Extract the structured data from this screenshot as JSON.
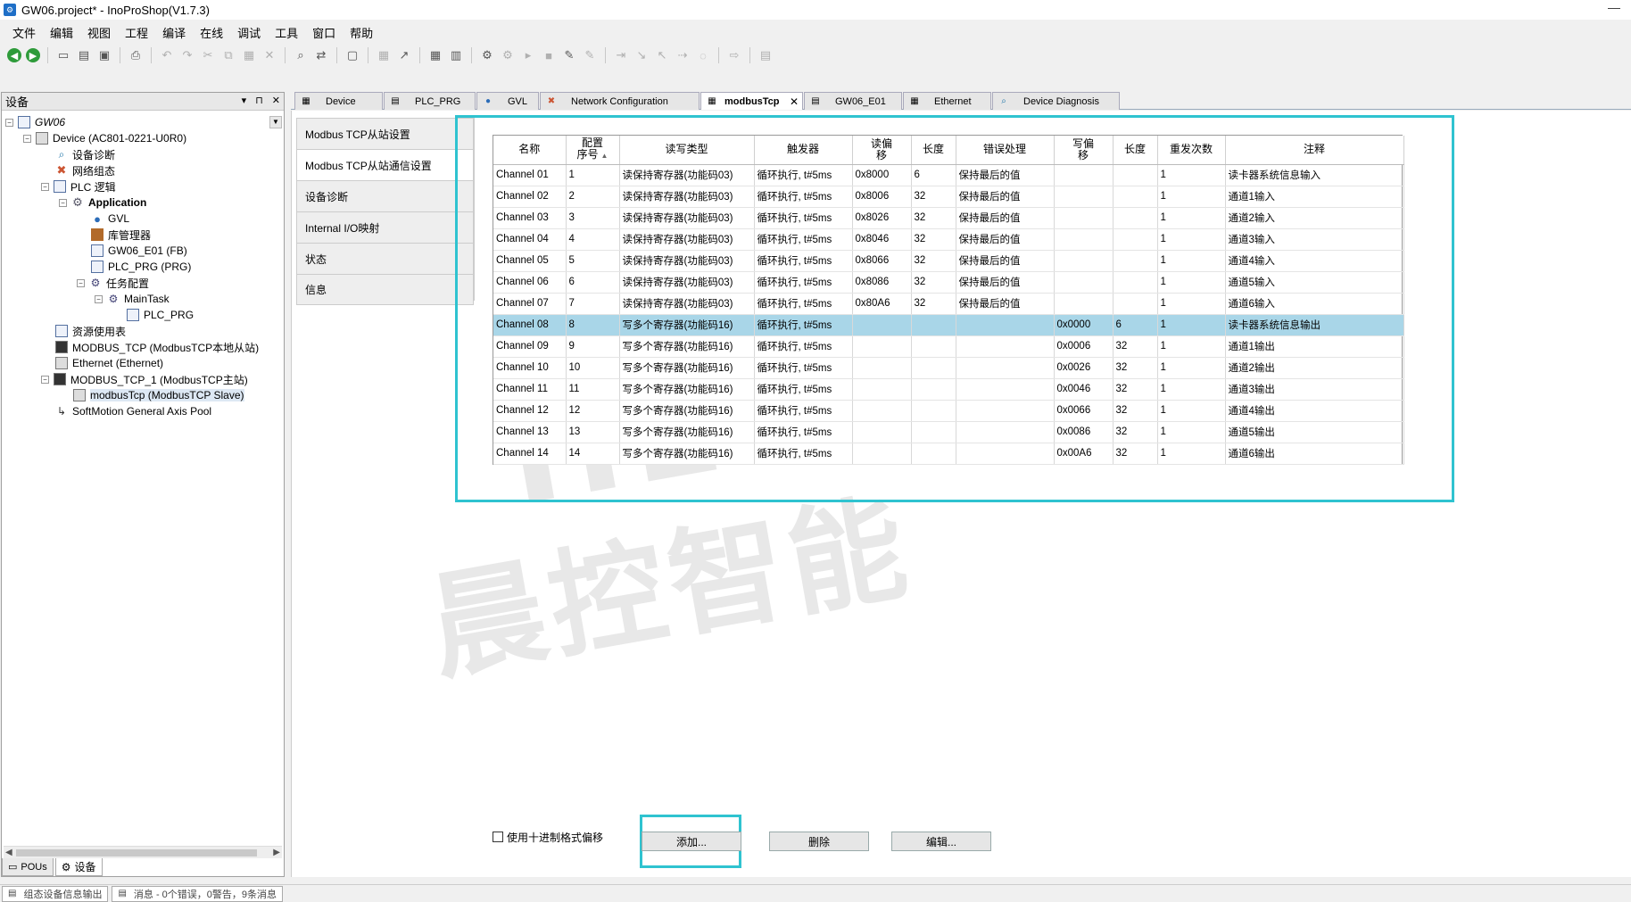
{
  "window": {
    "title": "GW06.project* - InoProShop(V1.7.3)",
    "minimize": "—"
  },
  "menu": [
    "文件",
    "编辑",
    "视图",
    "工程",
    "编译",
    "在线",
    "调试",
    "工具",
    "窗口",
    "帮助"
  ],
  "device_panel": {
    "title": "设备",
    "pin": "⊓",
    "close": "✕",
    "dropdown": "▾",
    "root": "GW06",
    "nodes": [
      {
        "label": "Device (AC801-0221-U0R0)",
        "icon": "device-icon"
      },
      {
        "label": "设备诊断",
        "icon": "diagnosis-icon"
      },
      {
        "label": "网络组态",
        "icon": "network-config-icon"
      },
      {
        "label": "PLC 逻辑",
        "icon": "plc-logic-icon"
      },
      {
        "label": "Application",
        "icon": "application-gear-icon"
      },
      {
        "label": "GVL",
        "icon": "gvl-globe-icon"
      },
      {
        "label": "库管理器",
        "icon": "library-manager-icon"
      },
      {
        "label": "GW06_E01 (FB)",
        "icon": "fb-document-icon"
      },
      {
        "label": "PLC_PRG (PRG)",
        "icon": "prg-document-icon"
      },
      {
        "label": "任务配置",
        "icon": "task-config-icon"
      },
      {
        "label": "MainTask",
        "icon": "task-icon"
      },
      {
        "label": "PLC_PRG",
        "icon": "prg-call-icon"
      },
      {
        "label": "资源使用表",
        "icon": "resource-table-icon"
      },
      {
        "label": "MODBUS_TCP (ModbusTCP本地从站)",
        "icon": "modbus-device-icon"
      },
      {
        "label": "Ethernet (Ethernet)",
        "icon": "ethernet-device-icon"
      },
      {
        "label": "MODBUS_TCP_1 (ModbusTCP主站)",
        "icon": "modbus-device-icon"
      },
      {
        "label": "modbusTcp (ModbusTCP Slave)",
        "icon": "modbus-slave-icon"
      },
      {
        "label": "SoftMotion General Axis Pool",
        "icon": "axis-pool-icon"
      }
    ],
    "bottom_tabs": [
      "POUs",
      "设备"
    ]
  },
  "doc_tabs": [
    {
      "label": "Device",
      "icon": "device-icon"
    },
    {
      "label": "PLC_PRG",
      "icon": "document-icon"
    },
    {
      "label": "GVL",
      "icon": "globe-icon"
    },
    {
      "label": "Network Configuration",
      "icon": "network-config-icon"
    },
    {
      "label": "modbusTcp",
      "icon": "device-icon",
      "close": "✕"
    },
    {
      "label": "GW06_E01",
      "icon": "document-icon"
    },
    {
      "label": "Ethernet",
      "icon": "device-icon"
    },
    {
      "label": "Device Diagnosis",
      "icon": "diagnosis-icon"
    }
  ],
  "side_nav": [
    "Modbus TCP从站设置",
    "Modbus TCP从站通信设置",
    "设备诊断",
    "Internal I/O映射",
    "状态",
    "信息"
  ],
  "table": {
    "headers": [
      "名称",
      "配置序号",
      "读写类型",
      "触发器",
      "读偏移",
      "长度",
      "错误处理",
      "写偏移",
      "长度",
      "重发次数",
      "注释"
    ],
    "header_lines": [
      [
        "名称"
      ],
      [
        "配置",
        "序号"
      ],
      [
        "读写类型"
      ],
      [
        "触发器"
      ],
      [
        "读偏",
        "移"
      ],
      [
        "长度"
      ],
      [
        "错误处理"
      ],
      [
        "写偏",
        "移"
      ],
      [
        "长度"
      ],
      [
        "重发次数"
      ],
      [
        "注释"
      ]
    ],
    "sort_indicator": "▲",
    "rows": [
      [
        "Channel 01",
        "1",
        "读保持寄存器(功能码03)",
        "循环执行, t#5ms",
        "0x8000",
        "6",
        "保持最后的值",
        "",
        "",
        "1",
        "读卡器系统信息输入"
      ],
      [
        "Channel 02",
        "2",
        "读保持寄存器(功能码03)",
        "循环执行, t#5ms",
        "0x8006",
        "32",
        "保持最后的值",
        "",
        "",
        "1",
        "通道1输入"
      ],
      [
        "Channel 03",
        "3",
        "读保持寄存器(功能码03)",
        "循环执行, t#5ms",
        "0x8026",
        "32",
        "保持最后的值",
        "",
        "",
        "1",
        "通道2输入"
      ],
      [
        "Channel 04",
        "4",
        "读保持寄存器(功能码03)",
        "循环执行, t#5ms",
        "0x8046",
        "32",
        "保持最后的值",
        "",
        "",
        "1",
        "通道3输入"
      ],
      [
        "Channel 05",
        "5",
        "读保持寄存器(功能码03)",
        "循环执行, t#5ms",
        "0x8066",
        "32",
        "保持最后的值",
        "",
        "",
        "1",
        "通道4输入"
      ],
      [
        "Channel 06",
        "6",
        "读保持寄存器(功能码03)",
        "循环执行, t#5ms",
        "0x8086",
        "32",
        "保持最后的值",
        "",
        "",
        "1",
        "通道5输入"
      ],
      [
        "Channel 07",
        "7",
        "读保持寄存器(功能码03)",
        "循环执行, t#5ms",
        "0x80A6",
        "32",
        "保持最后的值",
        "",
        "",
        "1",
        "通道6输入"
      ],
      [
        "Channel 08",
        "8",
        "写多个寄存器(功能码16)",
        "循环执行, t#5ms",
        "",
        "",
        "",
        "0x0000",
        "6",
        "1",
        "读卡器系统信息输出"
      ],
      [
        "Channel 09",
        "9",
        "写多个寄存器(功能码16)",
        "循环执行, t#5ms",
        "",
        "",
        "",
        "0x0006",
        "32",
        "1",
        "通道1输出"
      ],
      [
        "Channel 10",
        "10",
        "写多个寄存器(功能码16)",
        "循环执行, t#5ms",
        "",
        "",
        "",
        "0x0026",
        "32",
        "1",
        "通道2输出"
      ],
      [
        "Channel 11",
        "11",
        "写多个寄存器(功能码16)",
        "循环执行, t#5ms",
        "",
        "",
        "",
        "0x0046",
        "32",
        "1",
        "通道3输出"
      ],
      [
        "Channel 12",
        "12",
        "写多个寄存器(功能码16)",
        "循环执行, t#5ms",
        "",
        "",
        "",
        "0x0066",
        "32",
        "1",
        "通道4输出"
      ],
      [
        "Channel 13",
        "13",
        "写多个寄存器(功能码16)",
        "循环执行, t#5ms",
        "",
        "",
        "",
        "0x0086",
        "32",
        "1",
        "通道5输出"
      ],
      [
        "Channel 14",
        "14",
        "写多个寄存器(功能码16)",
        "循环执行, t#5ms",
        "",
        "",
        "",
        "0x00A6",
        "32",
        "1",
        "通道6输出"
      ]
    ],
    "selected_row": 8
  },
  "controls": {
    "checkbox_label": "使用十进制格式偏移",
    "checked": false,
    "add": "添加...",
    "delete": "删除",
    "edit": "编辑..."
  },
  "status": [
    "组态设备信息输出",
    "消息 - 0个错误，0警告，9条消息"
  ],
  "watermark": {
    "en": "HENK",
    "cn": "晨控智能"
  },
  "colors": {
    "highlight": "#2fc3d0",
    "selected_row": "#a9d6e8"
  }
}
